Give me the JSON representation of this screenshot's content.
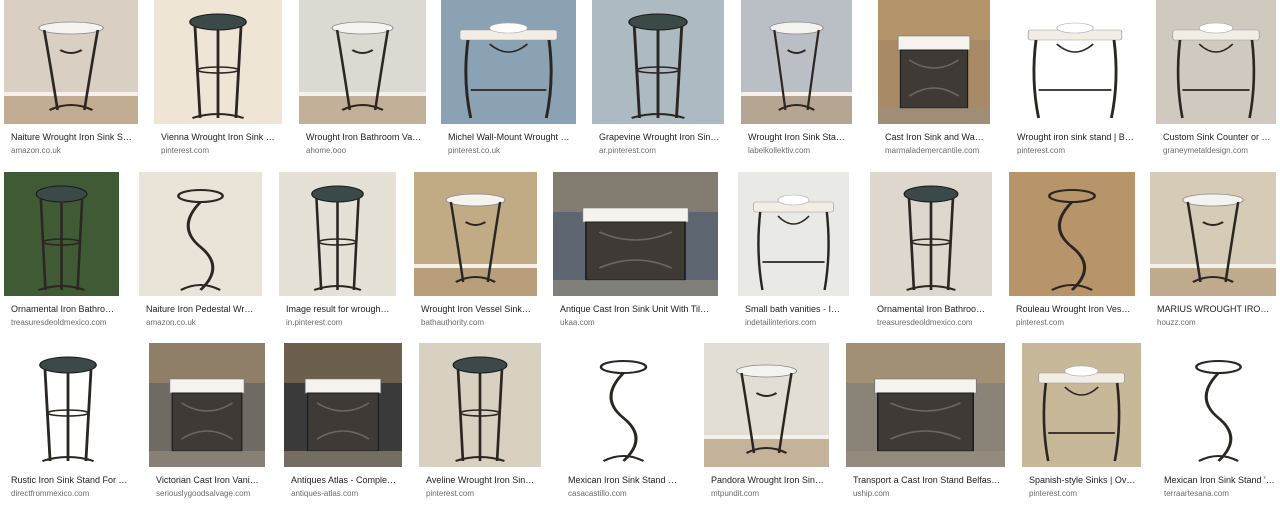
{
  "rows": [
    [
      {
        "caption": "Naiture Wrought Iron Sink Stan...",
        "domain": "amazon.co.uk",
        "bg": "#d9cfc2",
        "scene": "stand-wall"
      },
      {
        "caption": "Vienna Wrought Iron Sink Sta...",
        "domain": "pinterest.com",
        "bg": "#efe5d6",
        "scene": "vessel-tall"
      },
      {
        "caption": "Wrought Iron Bathroom Vanit...",
        "domain": "ahome.ooo",
        "bg": "#dcd8d2",
        "scene": "stand-wall"
      },
      {
        "caption": "Michel Wall-Mount Wrought Iro...",
        "domain": "pinterest.co.uk",
        "bg": "#8aa2b4",
        "scene": "console"
      },
      {
        "caption": "Grapevine Wrought Iron Sink ...",
        "domain": "ar.pinterest.com",
        "bg": "#aebac2",
        "scene": "vessel-tall"
      },
      {
        "caption": "Wrought Iron Sink Stand - ...",
        "domain": "labelkollektiv.com",
        "bg": "#b9bfc4",
        "scene": "stand-wall"
      },
      {
        "caption": "Cast Iron Sink and Wash S...",
        "domain": "marmalademercantile.com",
        "bg": "#a88a66",
        "scene": "cabinet"
      },
      {
        "caption": "Wrought iron sink stand | Bat...",
        "domain": "pinterest.com",
        "bg": "#ffffff",
        "scene": "console"
      },
      {
        "caption": "Custom Sink Counter or St...",
        "domain": "graneymetaldesign.com",
        "bg": "#cfc9bf",
        "scene": "console"
      }
    ],
    [
      {
        "caption": "Ornamental Iron Bathroom...",
        "domain": "treasuresdeoldmexico.com",
        "bg": "#3f5a34",
        "scene": "vessel-tall"
      },
      {
        "caption": "Naiture Iron Pedestal Wrou...",
        "domain": "amazon.co.uk",
        "bg": "#e9e3d8",
        "scene": "pedestal"
      },
      {
        "caption": "Image result for wrought ir...",
        "domain": "in.pinterest.com",
        "bg": "#e6e1d7",
        "scene": "vessel-tall"
      },
      {
        "caption": "Wrought Iron Vessel Sink St...",
        "domain": "bathauthority.com",
        "bg": "#c0ab84",
        "scene": "stand-wall"
      },
      {
        "caption": "Antique Cast Iron Sink Unit With Tiles a...",
        "domain": "ukaa.com",
        "bg": "#5d6670",
        "scene": "cabinet"
      },
      {
        "caption": "Small bath vanities - In Det...",
        "domain": "indetailinteriors.com",
        "bg": "#e9e9e6",
        "scene": "console"
      },
      {
        "caption": "Ornamental Iron Bathroom ...",
        "domain": "treasuresdeoldmexico.com",
        "bg": "#ddd7cd",
        "scene": "vessel-tall"
      },
      {
        "caption": "Rouleau Wrought Iron Vesse...",
        "domain": "pinterest.com",
        "bg": "#b8946a",
        "scene": "pedestal"
      },
      {
        "caption": "MARIUS WROUGHT IRON ...",
        "domain": "houzz.com",
        "bg": "#d6cbb7",
        "scene": "stand-wall"
      }
    ],
    [
      {
        "caption": "Rustic Iron Sink Stand For Ta...",
        "domain": "directfrommexico.com",
        "bg": "#ffffff",
        "scene": "vessel-tall"
      },
      {
        "caption": "Victorian Cast Iron Vanity /...",
        "domain": "seriouslygoodsalvage.com",
        "bg": "#6f6a63",
        "scene": "cabinet"
      },
      {
        "caption": "Antiques Atlas - Complete ...",
        "domain": "antiques-atlas.com",
        "bg": "#3a3a3a",
        "scene": "cabinet"
      },
      {
        "caption": "Aveline Wrought Iron Sink St...",
        "domain": "pinterest.com",
        "bg": "#d8d0c0",
        "scene": "vessel-tall"
      },
      {
        "caption": "Mexican Iron Sink Stand Maria",
        "domain": "casacastillo.com",
        "bg": "#ffffff",
        "scene": "pedestal"
      },
      {
        "caption": "Pandora Wrought Iron Sink ...",
        "domain": "mtpundit.com",
        "bg": "#e2ddd5",
        "scene": "stand-wall"
      },
      {
        "caption": "Transport a Cast Iron Stand Belfast S...",
        "domain": "uship.com",
        "bg": "#8a8478",
        "scene": "cabinet"
      },
      {
        "caption": "Spanish-style Sinks | Oval/...",
        "domain": "pinterest.com",
        "bg": "#c7b89a",
        "scene": "console"
      },
      {
        "caption": "Mexican Iron Sink Stand 'P...",
        "domain": "terraartesana.com",
        "bg": "#ffffff",
        "scene": "pedestal"
      }
    ]
  ]
}
